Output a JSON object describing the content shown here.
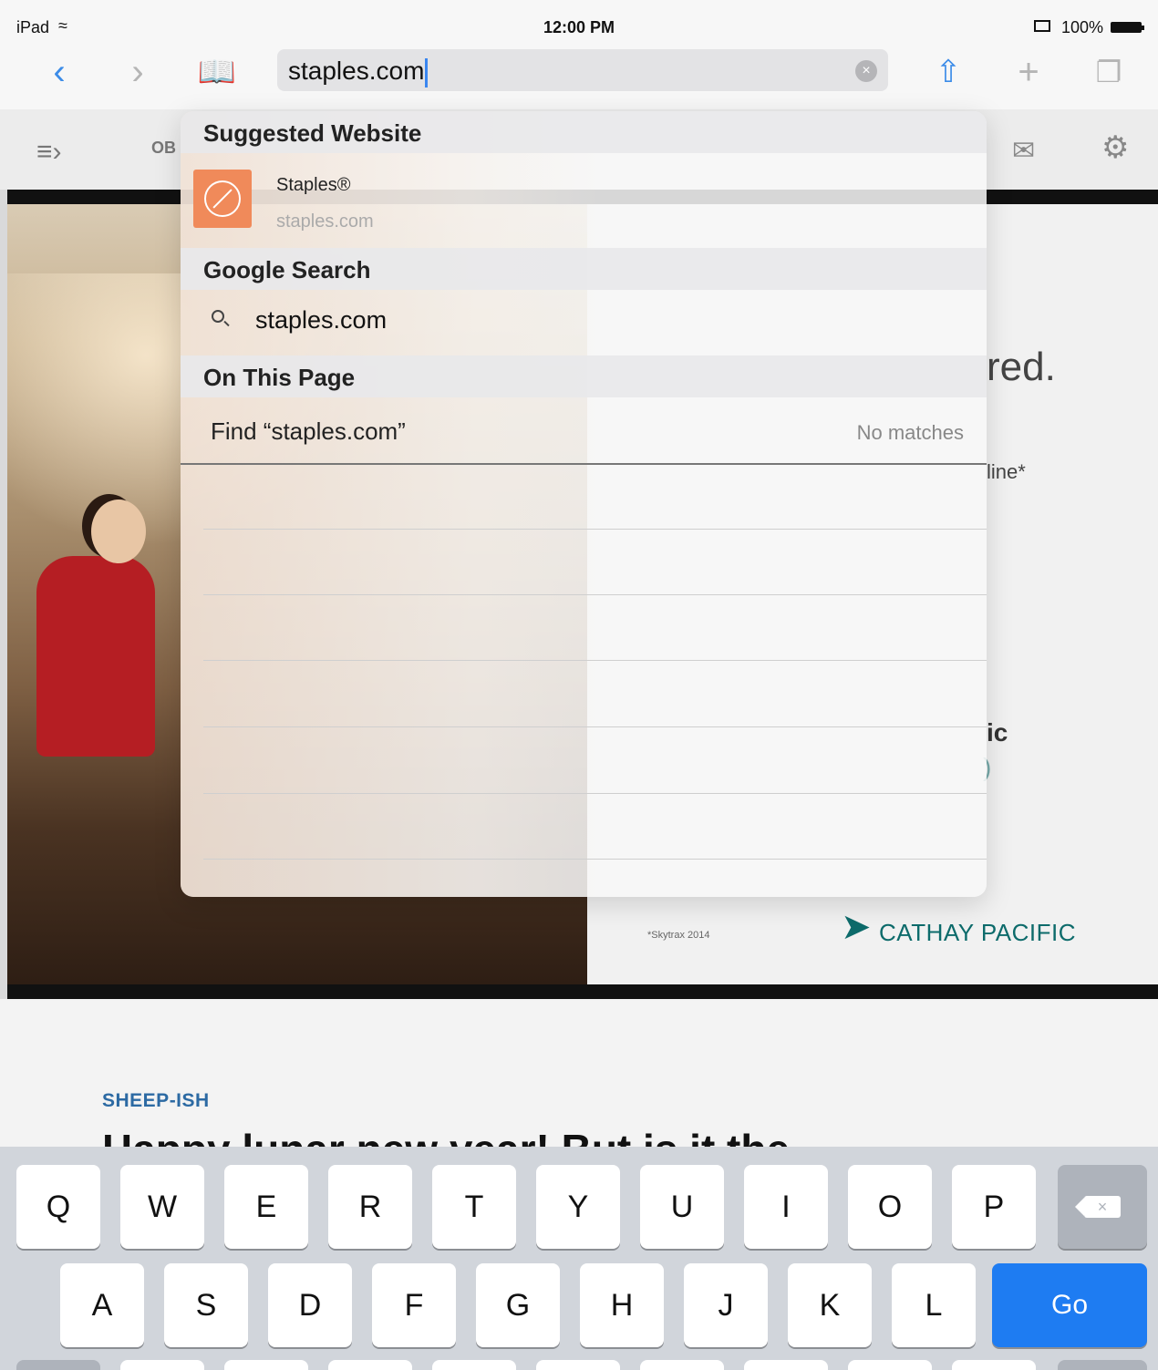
{
  "status_bar": {
    "device": "iPad",
    "time": "12:00 PM",
    "battery": "100%"
  },
  "toolbar": {
    "address_value": "staples.com",
    "icons": [
      "back-chevron-icon",
      "forward-chevron-icon",
      "bookmarks-icon",
      "share-icon",
      "new-tab-plus-icon",
      "tabs-icon"
    ]
  },
  "suggestions": {
    "suggested_header": "Suggested Website",
    "site_name": "Staples®",
    "site_url": "staples.com",
    "google_header": "Google Search",
    "google_query": "staples.com",
    "on_page_header": "On This Page",
    "find_label": "Find “staples.com”",
    "find_status": "No matches"
  },
  "page": {
    "toolbar_ob": "OB",
    "ad_red": "red.",
    "ad_line": "line*",
    "ad_ic": "ic",
    "ad_paren": ")",
    "skytrax": "*Skytrax 2014",
    "brand": "CATHAY PACIFIC",
    "kicker": "SHEEP-ISH",
    "headline": "Happy lunar new year! But is it the"
  },
  "keyboard": {
    "row1": [
      "Q",
      "W",
      "E",
      "R",
      "T",
      "Y",
      "U",
      "I",
      "O",
      "P"
    ],
    "row2": [
      "A",
      "S",
      "D",
      "F",
      "G",
      "H",
      "J",
      "K",
      "L"
    ],
    "go": "Go"
  },
  "colors": {
    "accent": "#1e7cf2",
    "site_tile": "#f08a5a",
    "brand_teal": "#0d6b6b"
  }
}
